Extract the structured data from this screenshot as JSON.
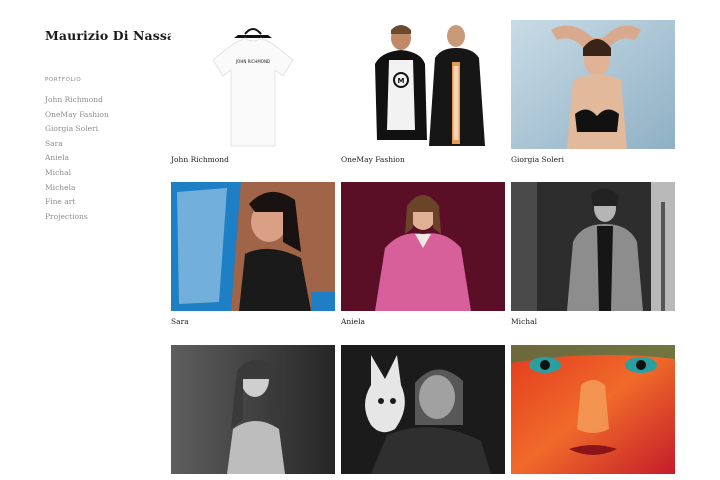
{
  "site": {
    "title": "Maurizio Di Nassau"
  },
  "sidebar": {
    "section_label": "PORTFOLIO",
    "items": [
      {
        "label": "John Richmond"
      },
      {
        "label": "OneMay Fashion"
      },
      {
        "label": "Giorgia Soleri"
      },
      {
        "label": "Sara"
      },
      {
        "label": "Aniela"
      },
      {
        "label": "Michal"
      },
      {
        "label": "Michela"
      },
      {
        "label": "Fine art"
      },
      {
        "label": "Projections"
      }
    ]
  },
  "gallery": {
    "items": [
      {
        "caption": "John Richmond",
        "shirt_text": "JOHN RICHMOND"
      },
      {
        "caption": "OneMay Fashion",
        "logo_text": "M"
      },
      {
        "caption": "Giorgia Soleri"
      },
      {
        "caption": "Sara"
      },
      {
        "caption": "Aniela"
      },
      {
        "caption": "Michal"
      },
      {
        "caption": ""
      },
      {
        "caption": ""
      },
      {
        "caption": ""
      }
    ]
  },
  "colors": {
    "title": "#1a1a1a",
    "nav_text": "#8d8d8d",
    "caption_text": "#222222",
    "aniela_bg": "#5a0f26",
    "aniela_coat": "#d8609a",
    "giorgia_bg": "#aec8d8",
    "sara_car": "#1f7fc4"
  }
}
